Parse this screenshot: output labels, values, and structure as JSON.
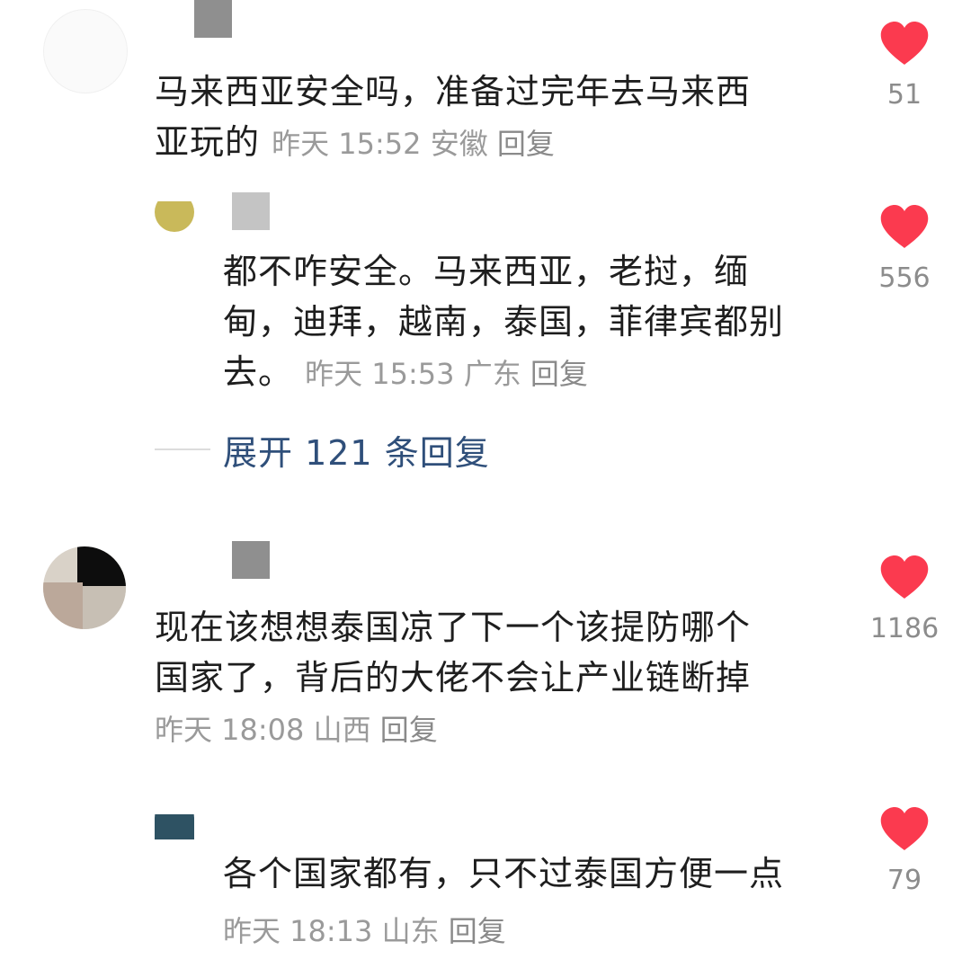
{
  "comments": [
    {
      "text_line1": "马来西亚安全吗，准备过完年去马来西",
      "text_line2": "亚玩的",
      "time": "昨天 15:52",
      "location": "安徽",
      "reply_label": "回复",
      "likes": "51",
      "reply": {
        "text_line1": "都不咋安全。马来西亚，老挝，缅",
        "text_line2": "甸，迪拜，越南，泰国，菲律宾都别",
        "text_line3": "去。",
        "time": "昨天 15:53",
        "location": "广东",
        "reply_label": "回复",
        "likes": "556"
      },
      "expand_label": "展开 121 条回复"
    },
    {
      "text_line1": "现在该想想泰国凉了下一个该提防哪个",
      "text_line2": "国家了，背后的大佬不会让产业链断掉",
      "time": "昨天 18:08",
      "location": "山西",
      "reply_label": "回复",
      "likes": "1186",
      "reply": {
        "text_line1": "各个国家都有，只不过泰国方便一点",
        "time": "昨天 18:13",
        "location": "山东",
        "reply_label": "回复",
        "likes": "79"
      }
    }
  ],
  "colors": {
    "heart": "#fb3a4f",
    "link": "#2f4f7a",
    "meta": "#9a9a9a"
  },
  "icons": {
    "like": "heart-icon"
  }
}
